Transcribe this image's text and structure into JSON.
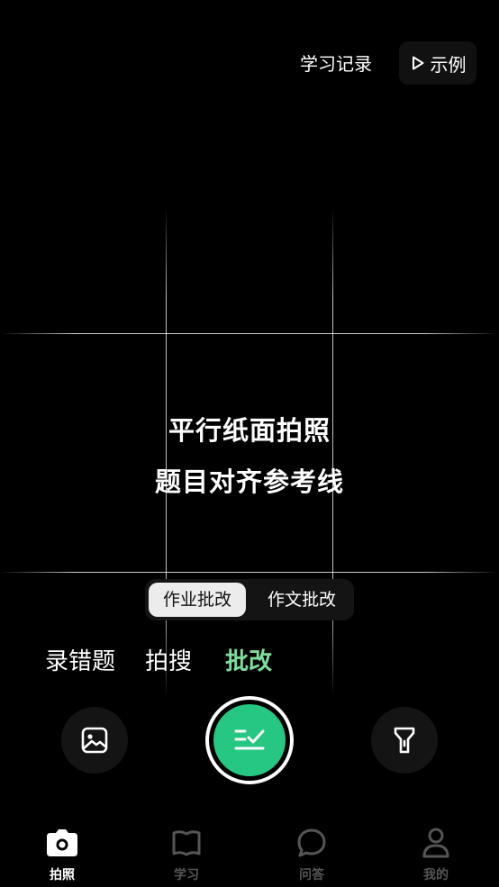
{
  "header": {
    "history_label": "学习记录",
    "example_label": "示例"
  },
  "hint": {
    "line1": "平行纸面拍照",
    "line2": "题目对齐参考线"
  },
  "grading_type": {
    "tabs": [
      {
        "label": "作业批改",
        "selected": true
      },
      {
        "label": "作文批改",
        "selected": false
      }
    ]
  },
  "mode_tabs": [
    {
      "label": "录错题",
      "selected": false
    },
    {
      "label": "拍搜",
      "selected": false
    },
    {
      "label": "批改",
      "selected": true
    }
  ],
  "controls": {
    "left_icon": "gallery-icon",
    "center_icon": "grade-check-icon",
    "right_icon": "flashlight-icon"
  },
  "bottom_nav": [
    {
      "label": "拍照",
      "icon": "camera-icon",
      "selected": true
    },
    {
      "label": "学习",
      "icon": "book-icon",
      "selected": false
    },
    {
      "label": "问答",
      "icon": "chat-icon",
      "selected": false
    },
    {
      "label": "我的",
      "icon": "user-icon",
      "selected": false
    }
  ],
  "colors": {
    "accent_green": "#25c782",
    "active_tab_text": "#7dde9c",
    "inactive_nav": "#555555"
  }
}
